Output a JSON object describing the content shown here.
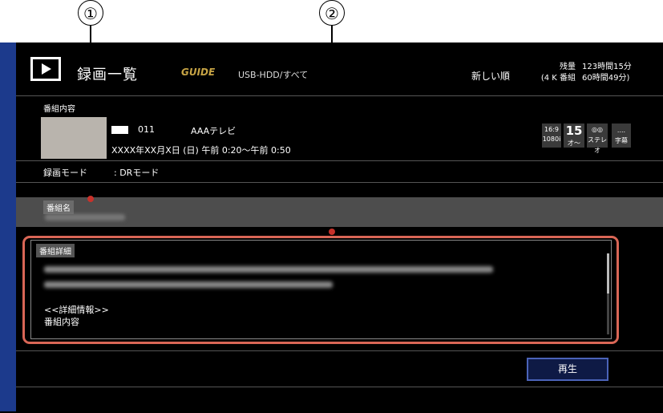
{
  "callouts": [
    {
      "number": "①"
    },
    {
      "number": "②"
    }
  ],
  "header": {
    "title": "録画一覧",
    "gguide_logo": "GUIDE",
    "source": "USB-HDD/すべて",
    "sort": "新しい順",
    "remain_labels": [
      "残量",
      "(4 K 番組"
    ],
    "remain_values": [
      "123時間15分",
      "60時間49分)"
    ]
  },
  "program_info": {
    "section_label": "番組内容",
    "channel_number": "011",
    "channel_name": "AAAテレビ",
    "airtime": "XXXX年XX月X日 (日)  午前 0:20〜午前 0:50",
    "rec_mode_label": "録画モード",
    "rec_mode_value": ": DRモード",
    "badges": [
      {
        "line1": "16:9",
        "line2": "1080i",
        "icon": "aspect-resolution-icon"
      },
      {
        "line1": "15",
        "line2": "才〜",
        "icon": "age-rating-icon"
      },
      {
        "line1": "◎◎",
        "line2": "ステレオ",
        "icon": "stereo-icon"
      },
      {
        "line1": "....",
        "line2": "字幕",
        "icon": "subtitle-icon"
      }
    ]
  },
  "program_name": {
    "section_label": "番組名"
  },
  "program_detail": {
    "section_label": "番組詳細",
    "detail_heading": "<<詳細情報>>",
    "detail_item": "番組内容"
  },
  "actions": {
    "play_label": "再生"
  },
  "colors": {
    "accent_border": "#d96656",
    "side_stripe": "#1c3a8c",
    "play_button_border": "#4b63b8"
  }
}
